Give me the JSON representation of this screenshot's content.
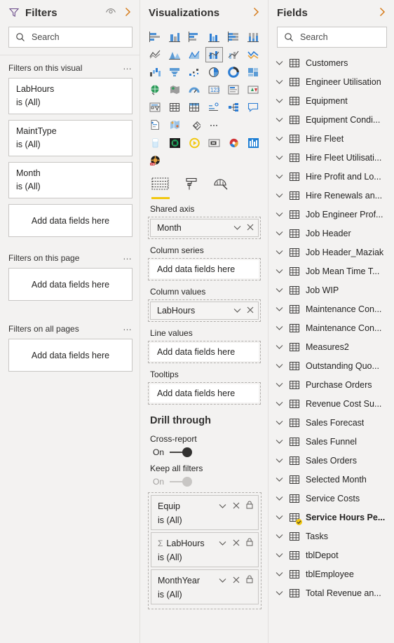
{
  "filters": {
    "title": "Filters",
    "eye_icon": "eye-icon",
    "expand_icon": "chevron-right-icon",
    "search": {
      "placeholder": "Search",
      "icon": "search-icon"
    },
    "sections": [
      {
        "title": "Filters on this visual",
        "menu": "…",
        "cards": [
          {
            "name": "LabHours",
            "value": "is (All)"
          },
          {
            "name": "MaintType",
            "value": "is (All)"
          },
          {
            "name": "Month",
            "value": "is (All)"
          }
        ],
        "dropzone": "Add data fields here"
      },
      {
        "title": "Filters on this page",
        "menu": "…",
        "cards": [],
        "dropzone": "Add data fields here"
      },
      {
        "title": "Filters on all pages",
        "menu": "…",
        "cards": [],
        "dropzone": "Add data fields here"
      }
    ]
  },
  "visualizations": {
    "title": "Visualizations",
    "expand_icon": "chevron-right-icon",
    "gallery": [
      "stacked-bar-chart-icon",
      "stacked-column-chart-icon",
      "clustered-bar-chart-icon",
      "clustered-column-chart-icon",
      "hundred-percent-stacked-bar-chart-icon",
      "hundred-percent-stacked-column-chart-icon",
      "line-chart-icon",
      "area-chart-icon",
      "stacked-area-chart-icon",
      "line-and-stacked-column-chart-icon",
      "line-and-clustered-column-chart-icon",
      "ribbon-chart-icon",
      "waterfall-chart-icon",
      "funnel-chart-icon",
      "scatter-chart-icon",
      "pie-chart-icon",
      "donut-chart-icon",
      "treemap-icon",
      "map-icon",
      "filled-map-icon",
      "gauge-icon",
      "card-icon",
      "multi-row-card-icon",
      "kpi-icon",
      "slicer-icon",
      "table-icon",
      "matrix-icon",
      "r-script-visual-icon",
      "decomposition-tree-icon",
      "key-influencers-icon",
      "paginated-report-icon",
      "arcgis-maps-icon",
      "power-apps-icon",
      "more-options-icon"
    ],
    "selected_gallery_index": 9,
    "custom_visuals": [
      "card-with-states-icon",
      "chiclet-slicer-icon",
      "play-axis-icon",
      "text-filter-icon",
      "sunburst-icon",
      "histogram-icon",
      "pro-visual-icon"
    ],
    "tabs": [
      {
        "name": "fields-tab",
        "icon": "fields-grid-icon",
        "active": true
      },
      {
        "name": "format-tab",
        "icon": "paint-roller-icon",
        "active": false
      },
      {
        "name": "analytics-tab",
        "icon": "magnifier-analytics-icon",
        "active": false
      }
    ],
    "wells": [
      {
        "label": "Shared axis",
        "value": "Month",
        "filled": true
      },
      {
        "label": "Column series",
        "value": "Add data fields here",
        "filled": false
      },
      {
        "label": "Column values",
        "value": "LabHours",
        "filled": true
      },
      {
        "label": "Line values",
        "value": "Add data fields here",
        "filled": false
      },
      {
        "label": "Tooltips",
        "value": "Add data fields here",
        "filled": false
      }
    ],
    "drill_through": {
      "title": "Drill through",
      "cross_report": {
        "label": "Cross-report",
        "state": "On",
        "enabled": true
      },
      "keep_all_filters": {
        "label": "Keep all filters",
        "state": "On",
        "enabled": false
      },
      "cards": [
        {
          "name": "Equip",
          "value": "is (All)",
          "measure": false
        },
        {
          "name": "LabHours",
          "value": "is (All)",
          "measure": true,
          "sigma": "Σ"
        },
        {
          "name": "MonthYear",
          "value": "is (All)",
          "measure": false
        }
      ]
    }
  },
  "fields": {
    "title": "Fields",
    "expand_icon": "chevron-right-icon",
    "search": {
      "placeholder": "Search",
      "icon": "search-icon"
    },
    "items": [
      {
        "label": "Customers",
        "active": false
      },
      {
        "label": "Engineer Utilisation",
        "active": false
      },
      {
        "label": "Equipment",
        "active": false
      },
      {
        "label": "Equipment Condi...",
        "active": false
      },
      {
        "label": "Hire Fleet",
        "active": false
      },
      {
        "label": "Hire Fleet Utilisati...",
        "active": false
      },
      {
        "label": "Hire Profit and Lo...",
        "active": false
      },
      {
        "label": "Hire Renewals an...",
        "active": false
      },
      {
        "label": "Job Engineer Prof...",
        "active": false
      },
      {
        "label": "Job Header",
        "active": false
      },
      {
        "label": "Job Header_Maziak",
        "active": false
      },
      {
        "label": "Job Mean Time T...",
        "active": false
      },
      {
        "label": "Job WIP",
        "active": false
      },
      {
        "label": "Maintenance Con...",
        "active": false
      },
      {
        "label": "Maintenance Con...",
        "active": false
      },
      {
        "label": "Measures2",
        "active": false
      },
      {
        "label": "Outstanding Quo...",
        "active": false
      },
      {
        "label": "Purchase Orders",
        "active": false
      },
      {
        "label": "Revenue Cost Su...",
        "active": false
      },
      {
        "label": "Sales Forecast",
        "active": false
      },
      {
        "label": "Sales Funnel",
        "active": false
      },
      {
        "label": "Sales Orders",
        "active": false
      },
      {
        "label": "Selected Month",
        "active": false
      },
      {
        "label": "Service Costs",
        "active": false
      },
      {
        "label": "Service Hours Pe...",
        "active": true
      },
      {
        "label": "Tasks",
        "active": false
      },
      {
        "label": "tblDepot",
        "active": false
      },
      {
        "label": "tblEmployee",
        "active": false
      },
      {
        "label": "Total Revenue an...",
        "active": false
      }
    ]
  },
  "colors": {
    "accent_orange": "#d67c1c",
    "accent_yellow": "#f2c811",
    "panel_bg": "#f3f2f1",
    "border": "#c8c6c4",
    "text": "#252423"
  }
}
